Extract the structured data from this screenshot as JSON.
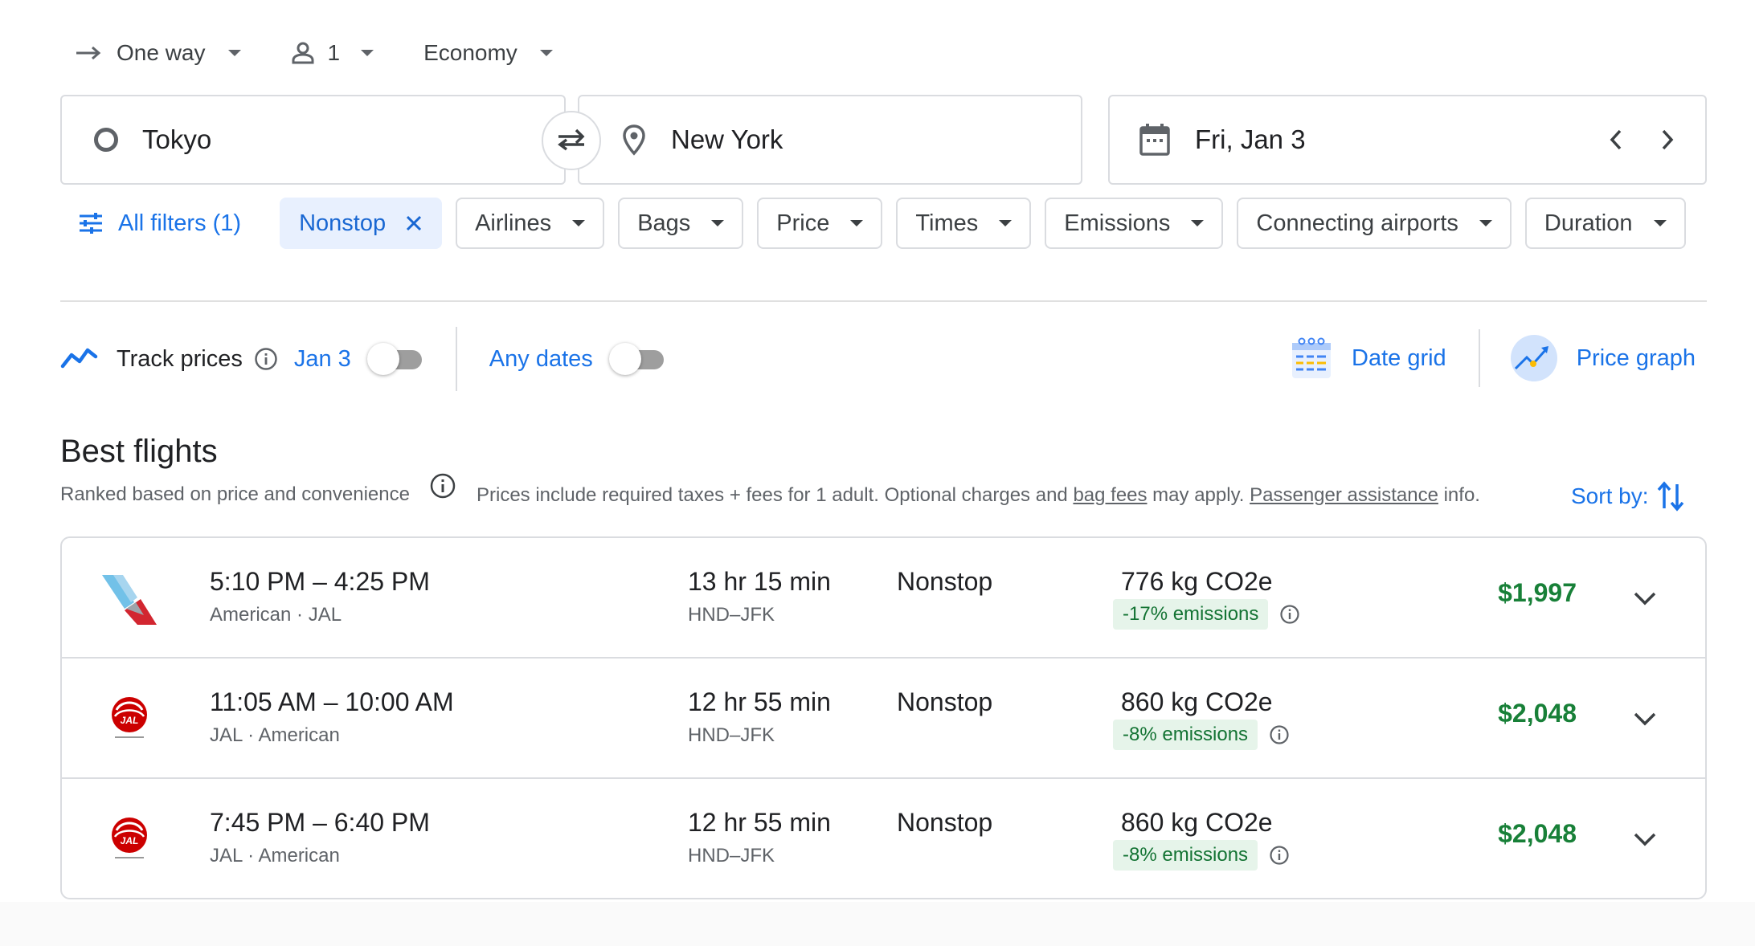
{
  "trip": {
    "type_label": "One way",
    "passengers": "1",
    "cabin": "Economy"
  },
  "search": {
    "origin": "Tokyo",
    "destination": "New York",
    "date": "Fri, Jan 3"
  },
  "filters": {
    "all_filters_label": "All filters (1)",
    "active_chip": "Nonstop",
    "chips": [
      "Airlines",
      "Bags",
      "Price",
      "Times",
      "Emissions",
      "Connecting airports",
      "Duration"
    ]
  },
  "track": {
    "label": "Track prices",
    "date": "Jan 3",
    "any_dates": "Any dates",
    "date_grid": "Date grid",
    "price_graph": "Price graph"
  },
  "best": {
    "title": "Best flights",
    "subtitle": "Ranked based on price and convenience",
    "disclaimer_pre": "Prices include required taxes + fees for 1 adult. Optional charges and ",
    "bag_fees_link": "bag fees",
    "disclaimer_mid": " may apply. ",
    "passenger_link": "Passenger assistance",
    "disclaimer_post": " info.",
    "sort_label": "Sort by:"
  },
  "flights": [
    {
      "airline_logo": "american-airlines-logo",
      "times": "5:10 PM – 4:25 PM",
      "carriers": "American · JAL",
      "duration": "13 hr 15 min",
      "route": "HND–JFK",
      "stops": "Nonstop",
      "co2": "776 kg CO2e",
      "emissions": "-17% emissions",
      "price": "$1,997"
    },
    {
      "airline_logo": "jal-logo",
      "times": "11:05 AM – 10:00 AM",
      "carriers": "JAL · American",
      "duration": "12 hr 55 min",
      "route": "HND–JFK",
      "stops": "Nonstop",
      "co2": "860 kg CO2e",
      "emissions": "-8% emissions",
      "price": "$2,048"
    },
    {
      "airline_logo": "jal-logo",
      "times": "7:45 PM – 6:40 PM",
      "carriers": "JAL · American",
      "duration": "12 hr 55 min",
      "route": "HND–JFK",
      "stops": "Nonstop",
      "co2": "860 kg CO2e",
      "emissions": "-8% emissions",
      "price": "$2,048"
    }
  ],
  "colors": {
    "accent": "#1a73e8",
    "price_green": "#188038",
    "emission_badge_bg": "#e6f4ea",
    "jal_red": "#cc0000"
  }
}
